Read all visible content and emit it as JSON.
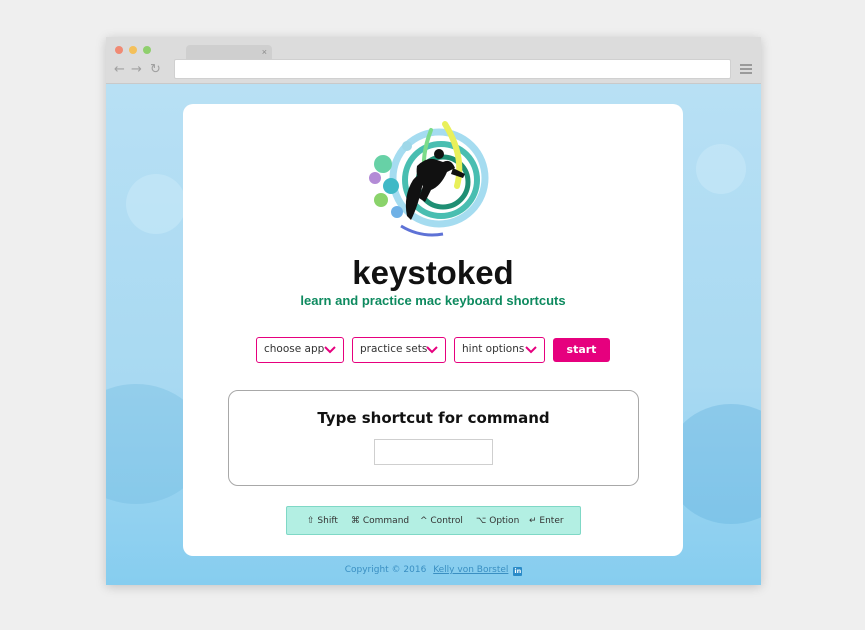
{
  "browser": {
    "tab_close_glyph": "×",
    "back_glyph": "←",
    "forward_glyph": "→",
    "reload_glyph": "↻",
    "url_value": ""
  },
  "app": {
    "brand": "keystoked",
    "tagline": "learn and practice mac keyboard shortcuts",
    "controls": {
      "choose_app": "choose app",
      "practice_sets": "practice sets",
      "hint_options": "hint options",
      "start": "start"
    },
    "prompt": "Type shortcut for command",
    "shortcut_input_value": "",
    "legend": {
      "shift": "⇧ Shift",
      "command": "⌘ Command",
      "control": "^ Control",
      "option": "⌥ Option",
      "enter": "↵ Enter"
    }
  },
  "footer": {
    "copyright": "Copyright © 2016",
    "author": "Kelly von Borstel",
    "linkedin_glyph": "in"
  },
  "icons": {
    "logo": "surfer-splash-logo",
    "chevron": "chevron-down-icon",
    "linkedin": "linkedin-icon"
  },
  "colors": {
    "accent_magenta": "#e6007e",
    "tagline_green": "#0e8a5f",
    "legend_bg": "#b3efe3",
    "legend_border": "#7fd8c6",
    "footer_text": "#3a8fc2",
    "linkedin_blue": "#2b8bc8"
  }
}
